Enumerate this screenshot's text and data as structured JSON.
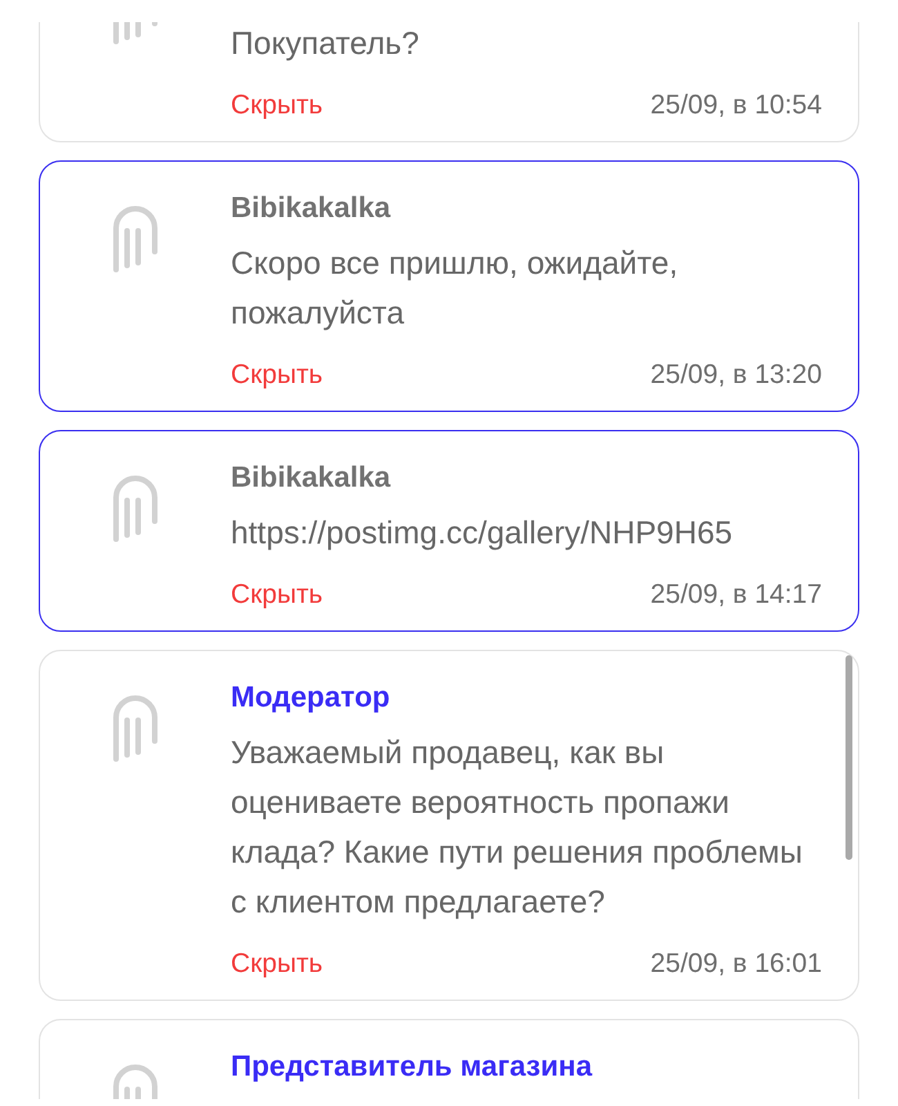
{
  "messages": [
    {
      "highlighted": false,
      "text": "Покупатель?",
      "hide": "Скрыть",
      "time": "25/09, в 10:54"
    },
    {
      "author": "Bibikakalka",
      "staff": false,
      "highlighted": true,
      "text": "Скоро все пришлю, ожидайте, пожалуйста",
      "hide": "Скрыть",
      "time": "25/09, в 13:20"
    },
    {
      "author": "Bibikakalka",
      "staff": false,
      "highlighted": true,
      "text": "https://postimg.cc/gallery/NHP9H65",
      "hide": "Скрыть",
      "time": "25/09, в 14:17"
    },
    {
      "author": "Модератор",
      "staff": true,
      "highlighted": false,
      "text": "Уважаемый продавец, как вы оцениваете вероятность пропажи клада? Какие пути решения проблемы с клиентом предлагаете?",
      "hide": "Скрыть",
      "time": "25/09, в 16:01"
    },
    {
      "author": "Представитель магазина",
      "staff": true,
      "highlighted": false
    }
  ]
}
